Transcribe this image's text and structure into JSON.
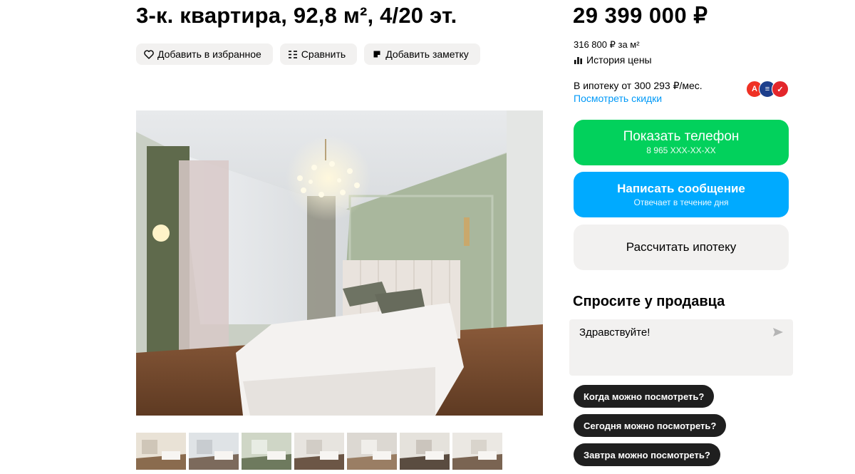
{
  "listing": {
    "title": "3-к. квартира, 92,8 м², 4/20 эт.",
    "actions": {
      "favorite": "Добавить в избранное",
      "compare": "Сравнить",
      "note": "Добавить заметку"
    }
  },
  "pricing": {
    "price": "29 399 000 ₽",
    "per_m2": "316 800 ₽ за м²",
    "history": "История цены",
    "mortgage": "В ипотеку от 300 293 ₽/мес.",
    "discounts": "Посмотреть скидки"
  },
  "contact": {
    "show_phone": "Показать телефон",
    "phone_masked": "8 965 XXX-XX-XX",
    "write_message": "Написать сообщение",
    "reply_time": "Отвечает в течение дня",
    "calc_mortgage": "Рассчитать ипотеку"
  },
  "ask": {
    "title": "Спросите у продавца",
    "message": "Здравствуйте!",
    "quick_questions": [
      "Когда можно посмотреть?",
      "Сегодня можно посмотреть?",
      "Завтра можно посмотреть?"
    ]
  },
  "gallery": {
    "thumbnail_count": 7
  },
  "colors": {
    "phone_button": "#02d15c",
    "message_button": "#00aaff",
    "link": "#0099f7",
    "chip": "#1f1f1f",
    "secondary_bg": "#f2f1f0"
  }
}
